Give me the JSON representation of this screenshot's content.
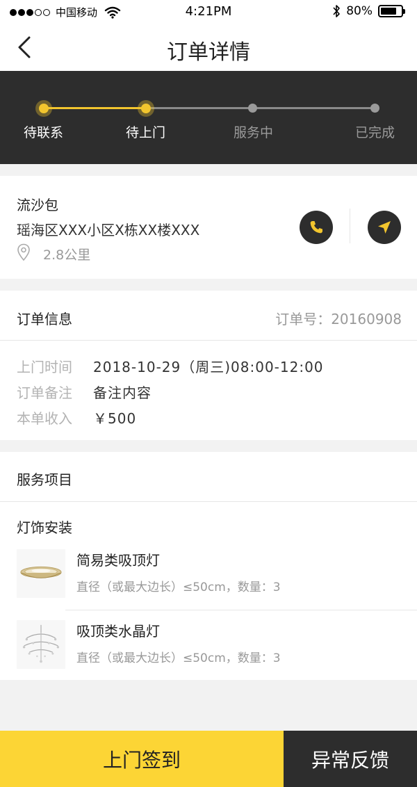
{
  "status_bar": {
    "carrier": "中国移动",
    "time": "4:21PM",
    "battery": "80%",
    "signal_bars": 3,
    "battery_level": 0.8
  },
  "nav": {
    "title": "订单详情",
    "back_icon": "chevron-left-icon"
  },
  "progress": {
    "steps": [
      {
        "label": "待联系",
        "state": "done"
      },
      {
        "label": "待上门",
        "state": "current"
      },
      {
        "label": "服务中",
        "state": "pending"
      },
      {
        "label": "已完成",
        "state": "pending"
      }
    ],
    "accent_color": "#f2c52e"
  },
  "customer": {
    "name": "流沙包",
    "address": "瑶海区XXX小区X栋XX楼XXX",
    "distance": "2.8公里",
    "call_icon": "phone-icon",
    "navigate_icon": "navigation-arrow-icon",
    "location_icon": "location-pin-icon"
  },
  "order_info": {
    "title": "订单信息",
    "order_no": "订单号：20160908",
    "rows": [
      {
        "key": "上门时间",
        "value": "2018-10-29（周三)08:00-12:00"
      },
      {
        "key": "订单备注",
        "value": "备注内容"
      },
      {
        "key": "本单收入",
        "value": "￥500"
      }
    ]
  },
  "services": {
    "title": "服务项目",
    "category": "灯饰安装",
    "items": [
      {
        "name": "简易类吸顶灯",
        "spec": "直径（或最大边长）≤50cm，数量：3",
        "image": "ceiling-lamp-image"
      },
      {
        "name": "吸顶类水晶灯",
        "spec": "直径（或最大边长）≤50cm，数量：3",
        "image": "crystal-chandelier-image"
      }
    ]
  },
  "actions": {
    "checkin_label": "上门签到",
    "feedback_label": "异常反馈",
    "checkin_color": "#fcd535",
    "feedback_color": "#2d2d2d"
  }
}
